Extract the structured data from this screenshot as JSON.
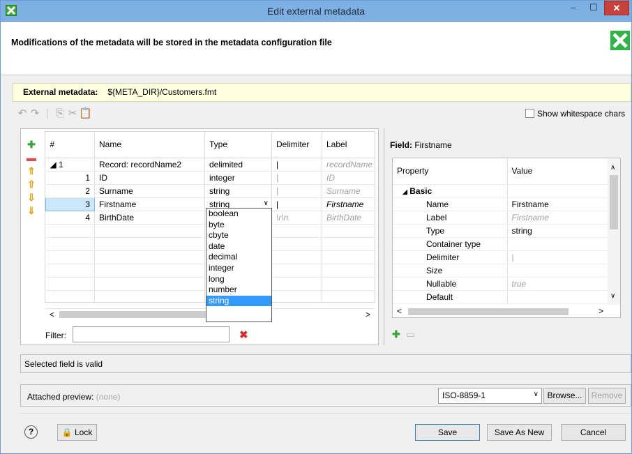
{
  "window": {
    "title": "Edit external metadata"
  },
  "header": {
    "message": "Modifications of the metadata will be stored in the metadata configuration file"
  },
  "external_metadata": {
    "label": "External metadata:",
    "value": "${META_DIR}/Customers.fmt"
  },
  "toolbar": {
    "show_whitespace_label": "Show whitespace chars"
  },
  "fields_table": {
    "columns": [
      "#",
      "Name",
      "Type",
      "Delimiter",
      "Label"
    ],
    "rows": [
      {
        "num": "1",
        "name": "Record: recordName2",
        "type": "delimited",
        "delimiter": "|",
        "label": "recordName"
      },
      {
        "num": "1",
        "name": "ID",
        "type": "integer",
        "delimiter": "|",
        "label": "ID"
      },
      {
        "num": "2",
        "name": "Surname",
        "type": "string",
        "delimiter": "|",
        "label": "Surname"
      },
      {
        "num": "3",
        "name": "Firstname",
        "type": "string",
        "delimiter": "|",
        "label": "Firstname"
      },
      {
        "num": "4",
        "name": "BirthDate",
        "type": "",
        "delimiter": "\\r\\n",
        "label": "BirthDate"
      }
    ]
  },
  "type_dropdown": {
    "options": [
      "boolean",
      "byte",
      "cbyte",
      "date",
      "decimal",
      "integer",
      "long",
      "number",
      "string"
    ],
    "selected": "string"
  },
  "filter": {
    "label": "Filter:",
    "value": ""
  },
  "property_panel": {
    "field_label": "Field: Firstname",
    "columns": [
      "Property",
      "Value"
    ],
    "group": "Basic",
    "rows": [
      {
        "property": "Name",
        "value": "Firstname"
      },
      {
        "property": "Label",
        "value": "Firstname"
      },
      {
        "property": "Type",
        "value": "string"
      },
      {
        "property": "Container type",
        "value": ""
      },
      {
        "property": "Delimiter",
        "value": "|"
      },
      {
        "property": "Size",
        "value": ""
      },
      {
        "property": "Nullable",
        "value": "true"
      },
      {
        "property": "Default",
        "value": ""
      }
    ]
  },
  "status": {
    "text": "Selected field is valid"
  },
  "preview": {
    "label": "Attached preview:",
    "value": "(none)",
    "encoding": "ISO-8859-1",
    "browse_label": "Browse...",
    "remove_label": "Remove"
  },
  "footer": {
    "help_label": "?",
    "lock_label": "Lock",
    "save_label": "Save",
    "save_as_new_label": "Save As New",
    "cancel_label": "Cancel"
  }
}
